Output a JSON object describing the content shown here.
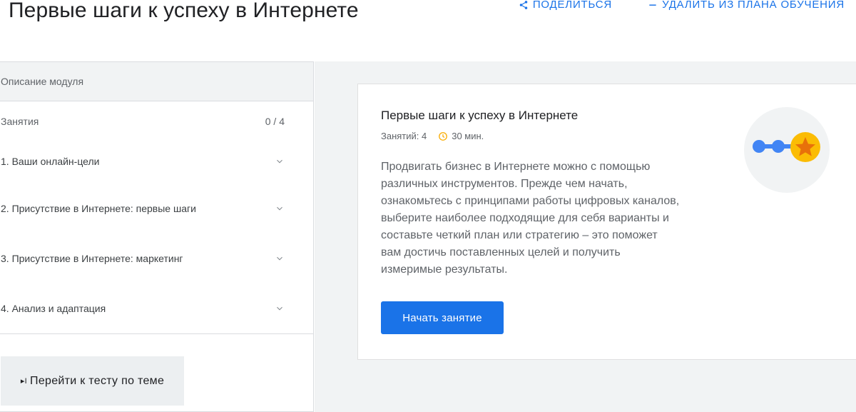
{
  "header": {
    "title": "Первые шаги к успеху в Интернете",
    "share_label": "ПОДЕЛИТЬСЯ",
    "remove_label": "УДАЛИТЬ ИЗ ПЛАНА ОБУЧЕНИЯ",
    "accent_color": "#1a73e8"
  },
  "sidebar": {
    "description_tab": "Описание модуля",
    "lessons_label": "Занятия",
    "lessons_progress": "0 / 4",
    "lessons": [
      {
        "label": "1. Ваши онлайн-цели",
        "icon": "chevron-down-icon"
      },
      {
        "label": "2. Присутствие в Интернете: первые шаги",
        "icon": "chevron-down-icon"
      },
      {
        "label": "3. Присутствие в Интернете: маркетинг",
        "icon": "chevron-down-icon"
      },
      {
        "label": "4. Анализ и адаптация",
        "icon": "chevron-down-icon"
      }
    ],
    "test_button_icon": "▸I",
    "test_button_label": "Перейти к тесту по теме"
  },
  "card": {
    "title": "Первые шаги к успеху в Интернете",
    "lessons_count": "Занятий: 4",
    "duration": "30 мин.",
    "description": "Продвигать бизнес в Интернете можно с помощью различных инструментов. Прежде чем начать, ознакомьтесь с принципами работы цифровых каналов, выберите наиболее подходящие для себя варианты и составьте четкий план или стратегию – это поможет вам достичь поставленных целей и получить измеримые результаты.",
    "start_button_label": "Начать занятие",
    "illustration_icon": "progress-path-star-icon",
    "star_color": "#fbbc04",
    "path_color": "#4285f4"
  }
}
